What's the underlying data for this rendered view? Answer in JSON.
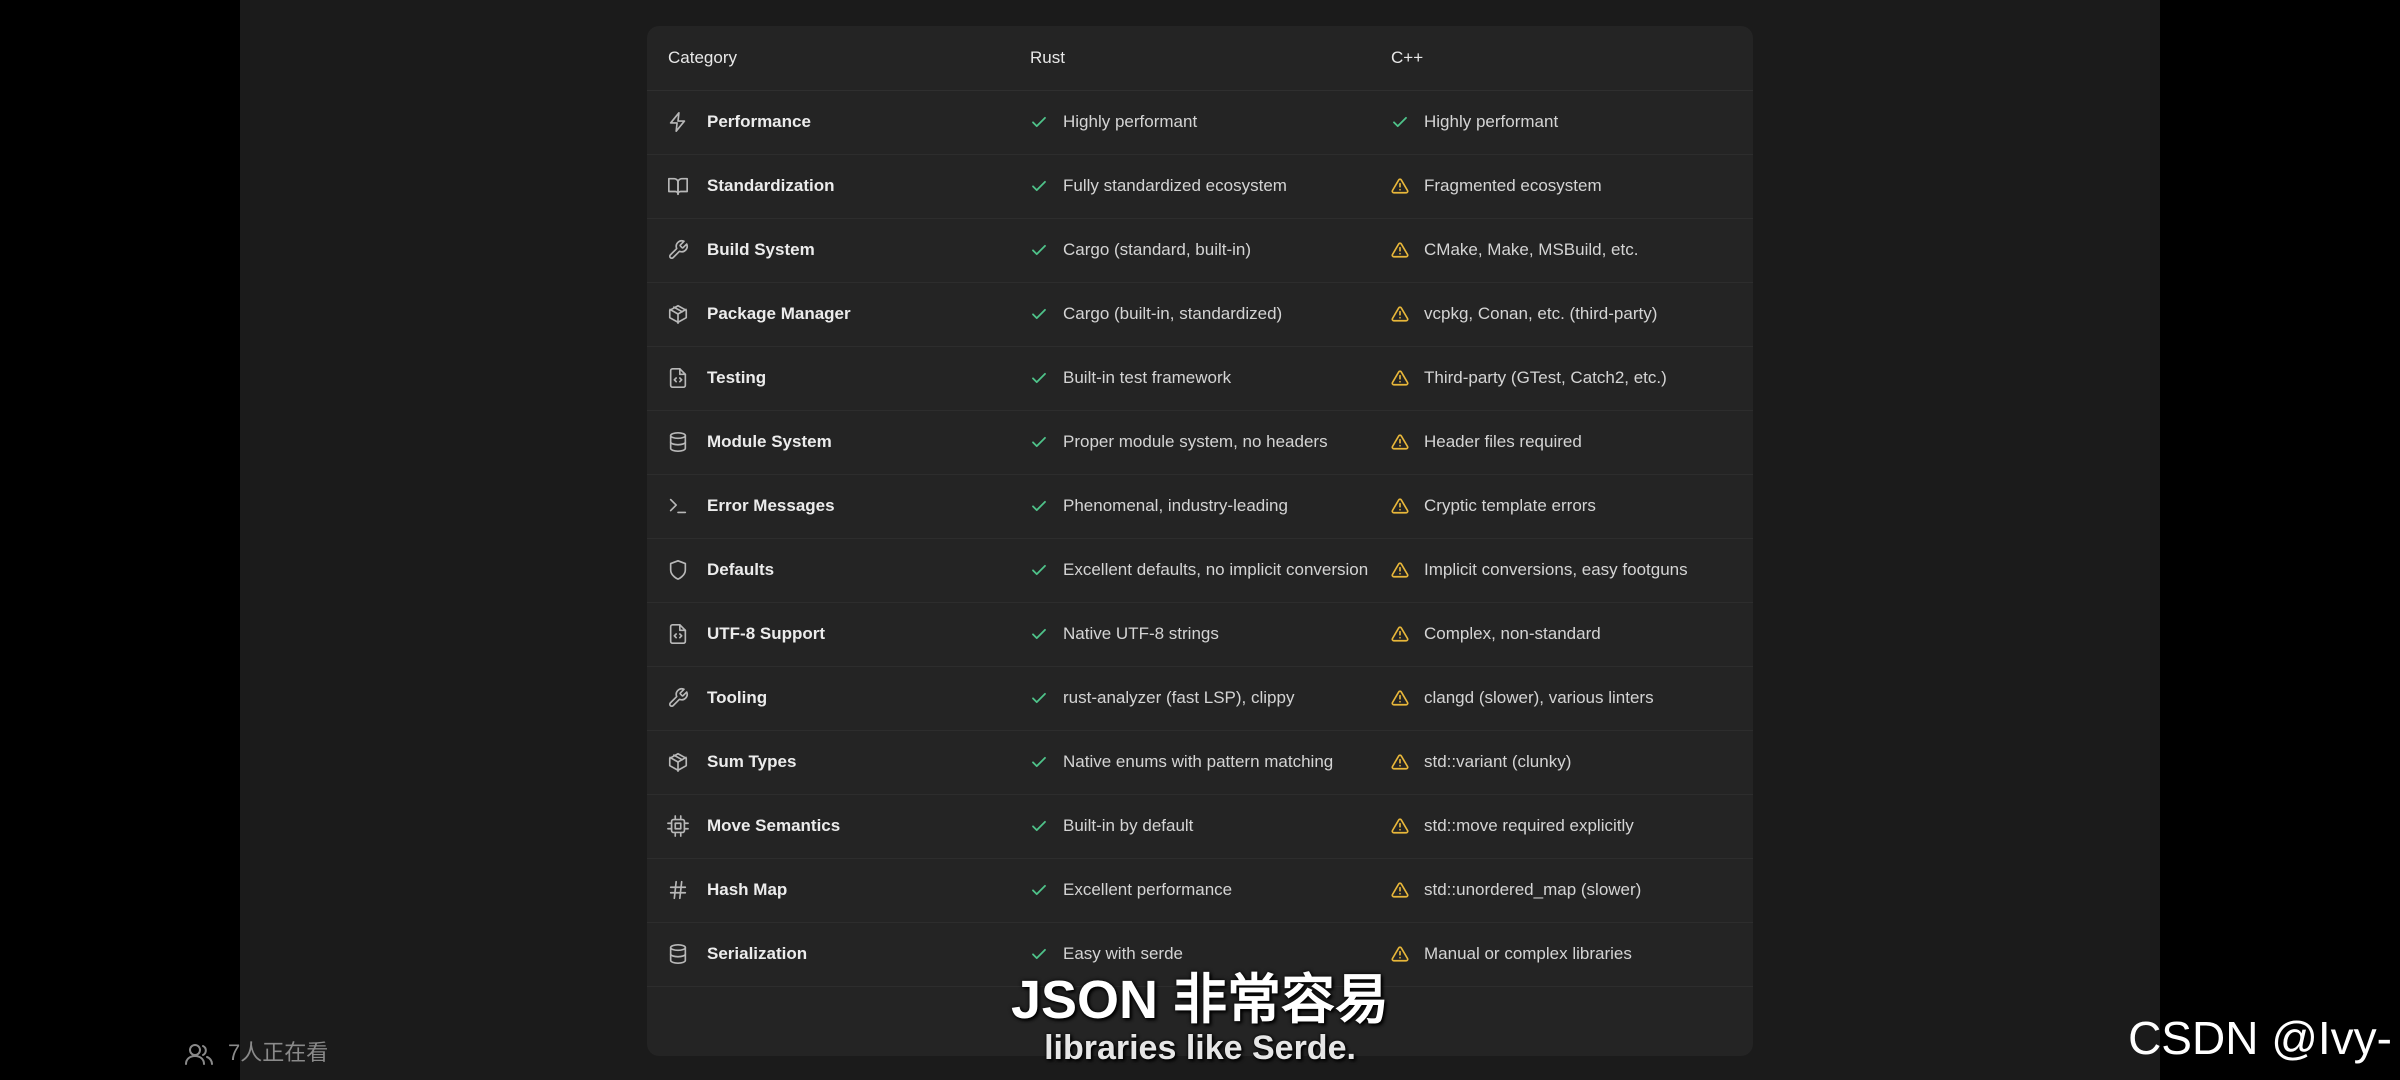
{
  "table": {
    "headers": {
      "category": "Category",
      "rust": "Rust",
      "cpp": "C++"
    },
    "rows": [
      {
        "icon": "zap-icon",
        "category": "Performance",
        "rust": "Highly performant",
        "rust_status": "check",
        "cpp": "Highly performant",
        "cpp_status": "check"
      },
      {
        "icon": "book-icon",
        "category": "Standardization",
        "rust": "Fully standardized ecosystem",
        "rust_status": "check",
        "cpp": "Fragmented ecosystem",
        "cpp_status": "warning"
      },
      {
        "icon": "wrench-icon",
        "category": "Build System",
        "rust": "Cargo (standard, built-in)",
        "rust_status": "check",
        "cpp": "CMake, Make, MSBuild, etc.",
        "cpp_status": "warning"
      },
      {
        "icon": "package-icon",
        "category": "Package Manager",
        "rust": "Cargo (built-in, standardized)",
        "rust_status": "check",
        "cpp": "vcpkg, Conan, etc. (third-party)",
        "cpp_status": "warning"
      },
      {
        "icon": "file-code-icon",
        "category": "Testing",
        "rust": "Built-in test framework",
        "rust_status": "check",
        "cpp": "Third-party (GTest, Catch2, etc.)",
        "cpp_status": "warning"
      },
      {
        "icon": "database-icon",
        "category": "Module System",
        "rust": "Proper module system, no headers",
        "rust_status": "check",
        "cpp": "Header files required",
        "cpp_status": "warning"
      },
      {
        "icon": "terminal-icon",
        "category": "Error Messages",
        "rust": "Phenomenal, industry-leading",
        "rust_status": "check",
        "cpp": "Cryptic template errors",
        "cpp_status": "warning"
      },
      {
        "icon": "shield-icon",
        "category": "Defaults",
        "rust": "Excellent defaults, no implicit conversion",
        "rust_status": "check",
        "cpp": "Implicit conversions, easy footguns",
        "cpp_status": "warning"
      },
      {
        "icon": "file-code-icon",
        "category": "UTF-8 Support",
        "rust": "Native UTF-8 strings",
        "rust_status": "check",
        "cpp": "Complex, non-standard",
        "cpp_status": "warning"
      },
      {
        "icon": "wrench-icon",
        "category": "Tooling",
        "rust": "rust-analyzer (fast LSP), clippy",
        "rust_status": "check",
        "cpp": "clangd (slower), various linters",
        "cpp_status": "warning"
      },
      {
        "icon": "package-icon",
        "category": "Sum Types",
        "rust": "Native enums with pattern matching",
        "rust_status": "check",
        "cpp": "std::variant (clunky)",
        "cpp_status": "warning"
      },
      {
        "icon": "cpu-icon",
        "category": "Move Semantics",
        "rust": "Built-in by default",
        "rust_status": "check",
        "cpp": "std::move required explicitly",
        "cpp_status": "warning"
      },
      {
        "icon": "hash-icon",
        "category": "Hash Map",
        "rust": "Excellent performance",
        "rust_status": "check",
        "cpp": "std::unordered_map (slower)",
        "cpp_status": "warning"
      },
      {
        "icon": "database-icon",
        "category": "Serialization",
        "rust": "Easy with serde",
        "rust_status": "check",
        "cpp": "Manual or complex libraries",
        "cpp_status": "warning"
      }
    ]
  },
  "colors": {
    "check": "#4fc38a",
    "warning": "#e8b73a",
    "icon": "#b8b8b8"
  },
  "subtitles": {
    "chinese": "JSON 非常容易",
    "english": "libraries like Serde."
  },
  "viewers": {
    "icon": "people-icon",
    "text": "7人正在看"
  },
  "watermark": "CSDN @Ivy-"
}
